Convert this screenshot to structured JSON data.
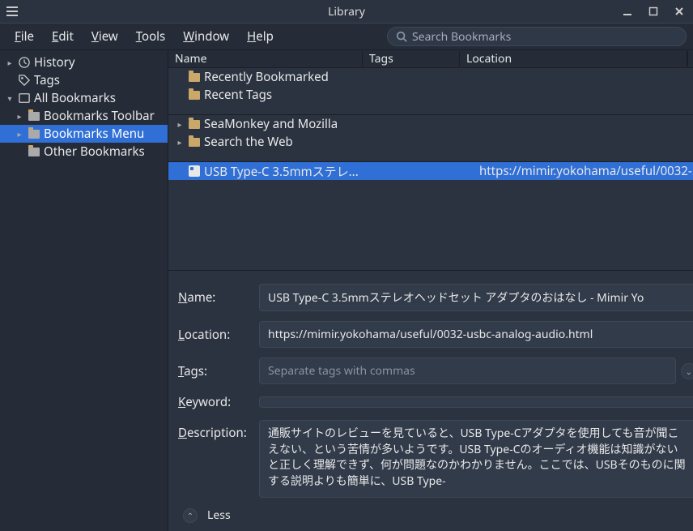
{
  "window": {
    "title": "Library"
  },
  "menubar": {
    "file": "File",
    "edit": "Edit",
    "view": "View",
    "tools": "Tools",
    "window": "Window",
    "help": "Help",
    "search_placeholder": "Search Bookmarks"
  },
  "sidebar": {
    "history": "History",
    "tags": "Tags",
    "all_bookmarks": "All Bookmarks",
    "bookmarks_toolbar": "Bookmarks Toolbar",
    "bookmarks_menu": "Bookmarks Menu",
    "other_bookmarks": "Other Bookmarks"
  },
  "columns": {
    "name": "Name",
    "tags": "Tags",
    "location": "Location"
  },
  "list": {
    "recently_bookmarked": "Recently Bookmarked",
    "recent_tags": "Recent Tags",
    "seamonkey": "SeaMonkey and Mozilla",
    "search_web": "Search the Web",
    "selected_name": "USB Type-C 3.5mmステレ...",
    "selected_location": "https://mimir.yokohama/useful/0032-..."
  },
  "details": {
    "labels": {
      "name": "Name:",
      "location": "Location:",
      "tags": "Tags:",
      "keyword": "Keyword:",
      "description": "Description:"
    },
    "name": "USB Type-C 3.5mmステレオヘッドセット アダプタのおはなし - Mimir Yo",
    "location": "https://mimir.yokohama/useful/0032-usbc-analog-audio.html",
    "tags_placeholder": "Separate tags with commas",
    "keyword": "",
    "description": "通販サイトのレビューを見ていると、USB Type-Cアダプタを使用しても音が聞こえない、という苦情が多いようです。USB Type-Cのオーディオ機能は知識がないと正しく理解できず、何が問題なのかわかりません。ここでは、USBそのものに関する説明よりも簡単に、USB Type-",
    "less": "Less"
  }
}
